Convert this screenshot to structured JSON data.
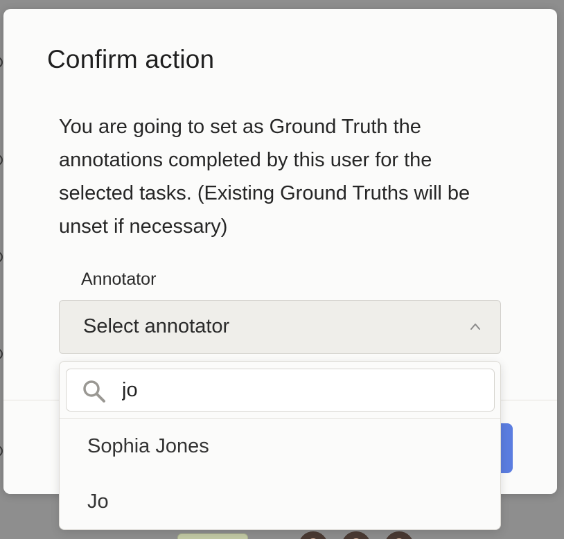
{
  "modal": {
    "title": "Confirm action",
    "message": "You are going to set as Ground Truth the annotations completed by this user for the selected tasks. (Existing Ground Truths will be unset if necessary)",
    "field_label": "Annotator",
    "select": {
      "placeholder": "Select annotator",
      "icon": "chevron-up-icon",
      "expanded": true
    }
  },
  "dropdown": {
    "search": {
      "icon": "search-icon",
      "value": "jo"
    },
    "options": [
      {
        "label": "Sophia Jones"
      },
      {
        "label": "Jo"
      }
    ]
  },
  "colors": {
    "primary_button": "#5b7de0",
    "modal_background": "#fbfbfa",
    "select_background": "#efeeea",
    "overlay": "#8e8e8e"
  }
}
